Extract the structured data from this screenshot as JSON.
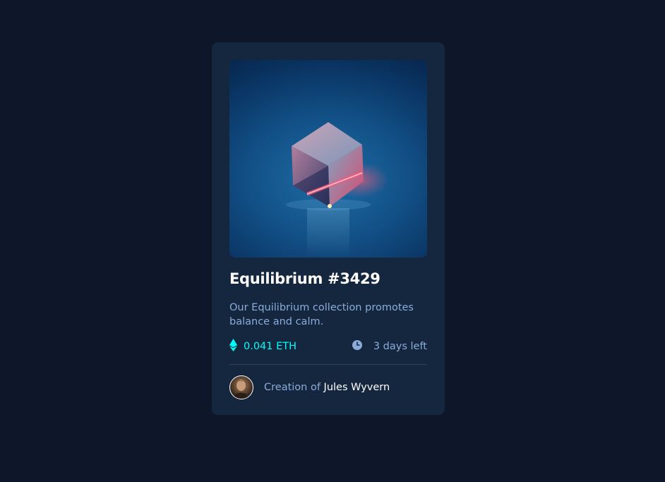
{
  "card": {
    "image_alt": "Equilibrium cube",
    "title": "Equilibrium #3429",
    "description": "Our Equilibrium collection promotes balance and calm.",
    "price": "0.041 ETH",
    "time_left": "3 days left",
    "creator_prefix": "Creation of ",
    "creator_name": "Jules Wyvern"
  },
  "colors": {
    "page_bg": "#0e1729",
    "card_bg": "#15263f",
    "accent_cyan": "#00fff8",
    "soft_blue": "#8bacd9",
    "white": "#ffffff"
  },
  "icons": {
    "price": "ethereum-icon",
    "time": "clock-icon"
  }
}
